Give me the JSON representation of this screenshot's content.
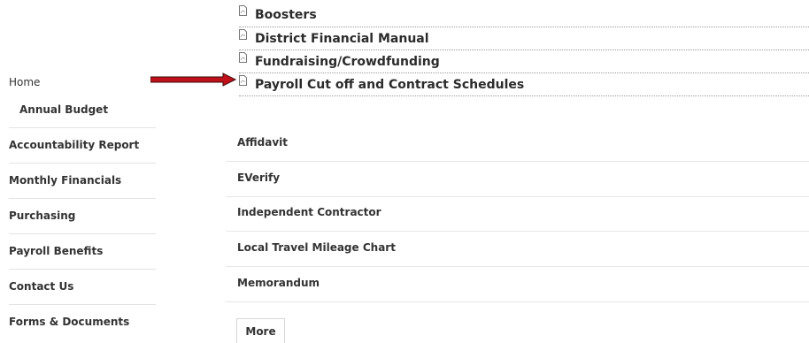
{
  "documents": [
    {
      "label": "Boosters",
      "icon": "pdf-icon"
    },
    {
      "label": "District Financial Manual",
      "icon": "pdf-icon"
    },
    {
      "label": "Fundraising/Crowdfunding",
      "icon": "pdf-icon"
    },
    {
      "label": "Payroll Cut off and Contract Schedules",
      "icon": "pdf-icon"
    }
  ],
  "sidebar": {
    "home": "Home",
    "sub_item": "Annual Budget",
    "items": [
      "Accountability Report",
      "Monthly Financials",
      "Purchasing",
      "Payroll Benefits",
      "Contact Us",
      "Forms & Documents"
    ]
  },
  "forms_list": {
    "items": [
      "Affidavit",
      "EVerify",
      "Independent Contractor",
      "Local Travel Mileage Chart",
      "Memorandum"
    ],
    "more_label": "More"
  },
  "colors": {
    "arrow": "#c0111b"
  }
}
